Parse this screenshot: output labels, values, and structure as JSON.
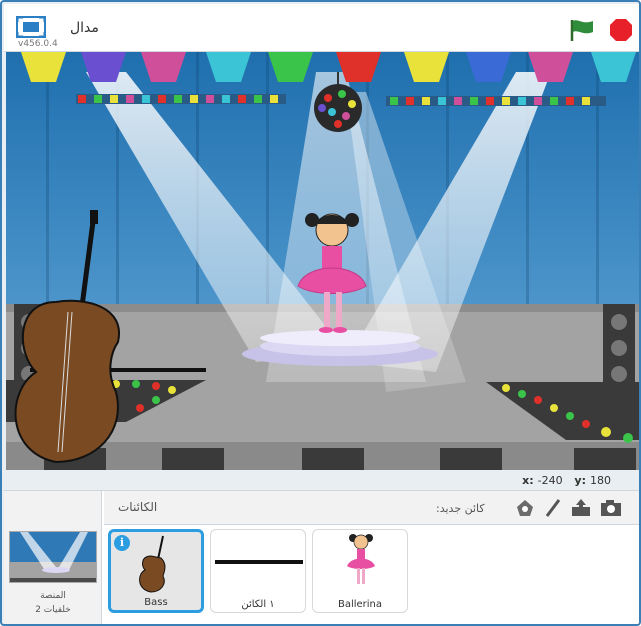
{
  "titlebar": {
    "project_title": "مدال",
    "version": "v456.0.4",
    "fullscreen_icon": "fullscreen-icon",
    "green_flag_icon": "green-flag-icon",
    "stop_icon": "stop-icon",
    "colors": {
      "green_flag": "#2f8c3a",
      "stop": "#e8202a"
    }
  },
  "stage": {
    "colors": {
      "backdrop_top": "#1f6fae",
      "backdrop_bottom": "#5fa3d6",
      "floor": "#9a9a9a"
    }
  },
  "coordinates": {
    "x_label": "x:",
    "x_value": "-240",
    "y_label": "y:",
    "y_value": "180"
  },
  "stage_panel": {
    "label": "المنصة",
    "backdrop_count": "2 خلفيات"
  },
  "sprites_pane": {
    "title": "الكائنات",
    "new_sprite_label": ":كائن جديد",
    "tools": [
      "paint-sprite-icon",
      "paintbrush-icon",
      "upload-icon",
      "camera-icon"
    ],
    "sprites": [
      {
        "name": "Bass",
        "selected": true,
        "info_badge": "i",
        "icon": "bass-thumbnail"
      },
      {
        "name": "١ الكائن",
        "selected": false,
        "icon": "line-thumbnail"
      },
      {
        "name": "Ballerina",
        "selected": false,
        "icon": "ballerina-thumbnail"
      }
    ],
    "colors": {
      "selected_border": "#2b9de0"
    }
  }
}
